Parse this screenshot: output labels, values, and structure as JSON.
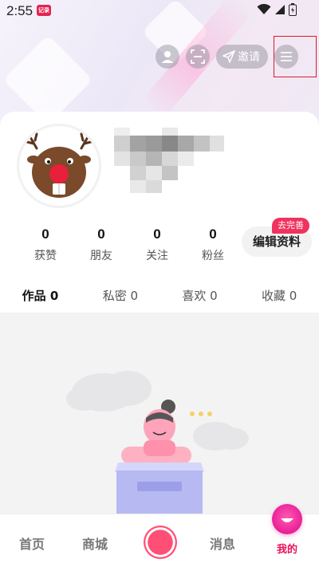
{
  "status_bar": {
    "time": "2:55",
    "app_badge": "记录"
  },
  "top_actions": {
    "invite_label": "邀请"
  },
  "stats": [
    {
      "num": "0",
      "label": "获赞"
    },
    {
      "num": "0",
      "label": "朋友"
    },
    {
      "num": "0",
      "label": "关注"
    },
    {
      "num": "0",
      "label": "粉丝"
    }
  ],
  "edit_profile": {
    "label": "编辑资料",
    "badge": "去完善"
  },
  "tabs": [
    {
      "label": "作品 0",
      "active": true
    },
    {
      "label": "私密 0",
      "active": false
    },
    {
      "label": "喜欢 0",
      "active": false
    },
    {
      "label": "收藏 0",
      "active": false
    }
  ],
  "bottom_nav": {
    "home": "首页",
    "mall": "商城",
    "messages": "消息",
    "me": "我的"
  },
  "colors": {
    "accent": "#f0325e",
    "me_icon": "#e81f97"
  }
}
